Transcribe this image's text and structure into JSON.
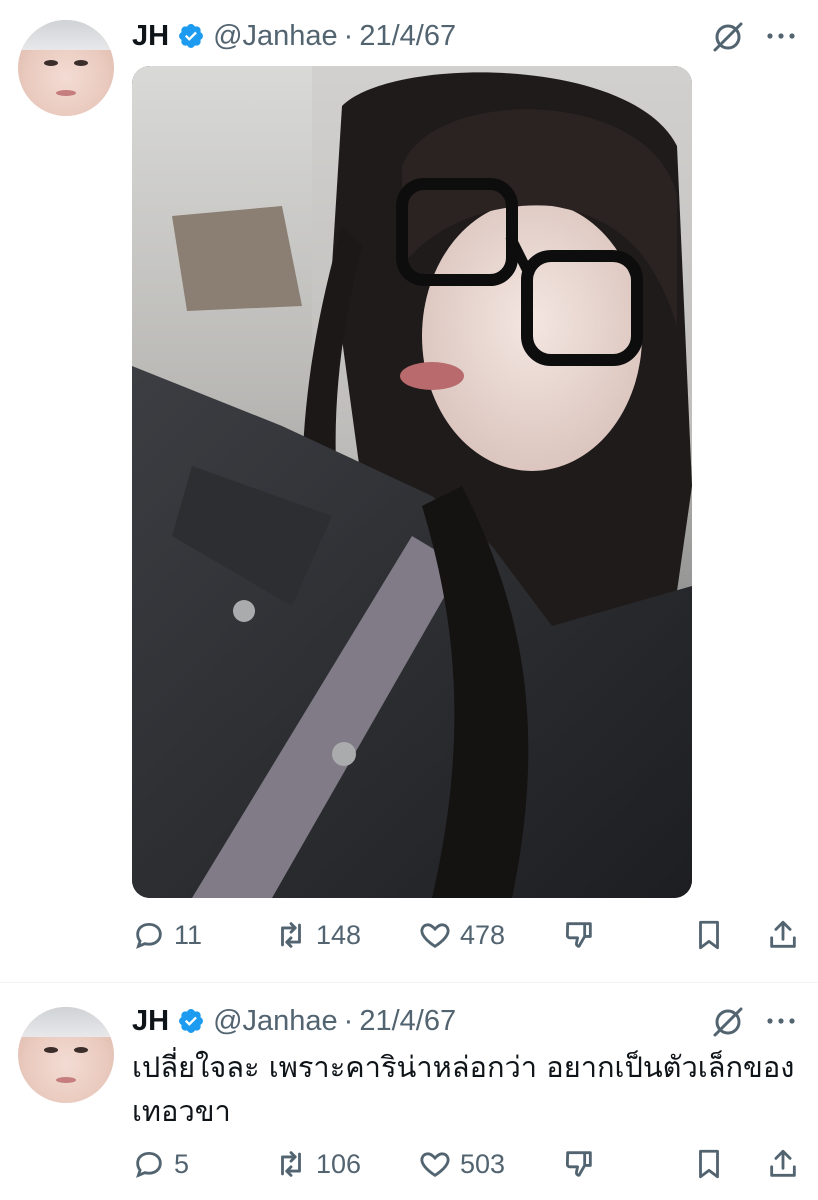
{
  "tweets": [
    {
      "author": {
        "name": "JH",
        "handle": "@Janhae",
        "verified": true
      },
      "separator": "·",
      "date": "21/4/67",
      "text": "",
      "media": {
        "type": "image",
        "description_icon": "photo"
      },
      "actions": {
        "replies": "11",
        "reposts": "148",
        "likes": "478"
      }
    },
    {
      "author": {
        "name": "JH",
        "handle": "@Janhae",
        "verified": true
      },
      "separator": "·",
      "date": "21/4/67",
      "text": "เปลี่ยใจละ เพราะคาริน่าหล่อกว่า อยากเป็นตัวเล็กของเทอวขา",
      "actions": {
        "replies": "5",
        "reposts": "106",
        "likes": "503"
      }
    }
  ],
  "colors": {
    "text_primary": "#0f1419",
    "text_secondary": "#536471",
    "verified_blue": "#1d9bf0",
    "divider": "#eff3f4"
  }
}
